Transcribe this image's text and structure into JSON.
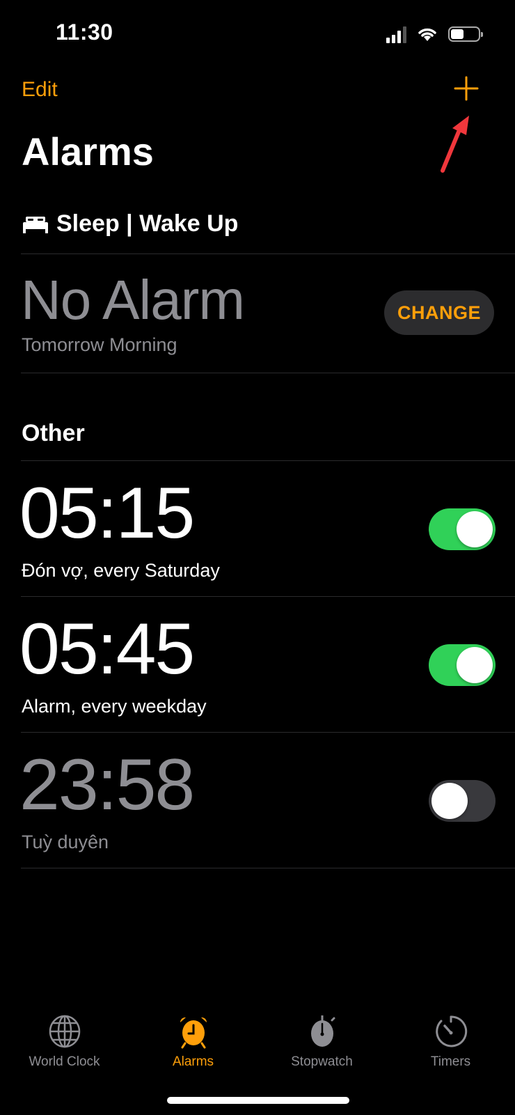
{
  "status_bar": {
    "time": "11:30"
  },
  "nav": {
    "edit_label": "Edit",
    "add_icon": "plus-icon"
  },
  "title": "Alarms",
  "sleep_section": {
    "header": "Sleep | Wake Up",
    "icon": "bed-icon",
    "primary": "No Alarm",
    "subtitle": "Tomorrow Morning",
    "change_label": "CHANGE"
  },
  "other_section": {
    "header": "Other"
  },
  "alarms": [
    {
      "time": "05:15",
      "label": "Đón vợ, every Saturday",
      "enabled": true
    },
    {
      "time": "05:45",
      "label": "Alarm, every weekday",
      "enabled": true
    },
    {
      "time": "23:58",
      "label": "Tuỳ duyên",
      "enabled": false
    }
  ],
  "tabs": [
    {
      "label": "World Clock",
      "icon": "globe-icon",
      "active": false
    },
    {
      "label": "Alarms",
      "icon": "alarm-clock-icon",
      "active": true
    },
    {
      "label": "Stopwatch",
      "icon": "stopwatch-icon",
      "active": false
    },
    {
      "label": "Timers",
      "icon": "timer-icon",
      "active": false
    }
  ],
  "colors": {
    "accent": "#ff9f0a",
    "toggle_on": "#30d158",
    "secondary_text": "#8e8e93",
    "annotation_arrow": "#f0373c"
  }
}
